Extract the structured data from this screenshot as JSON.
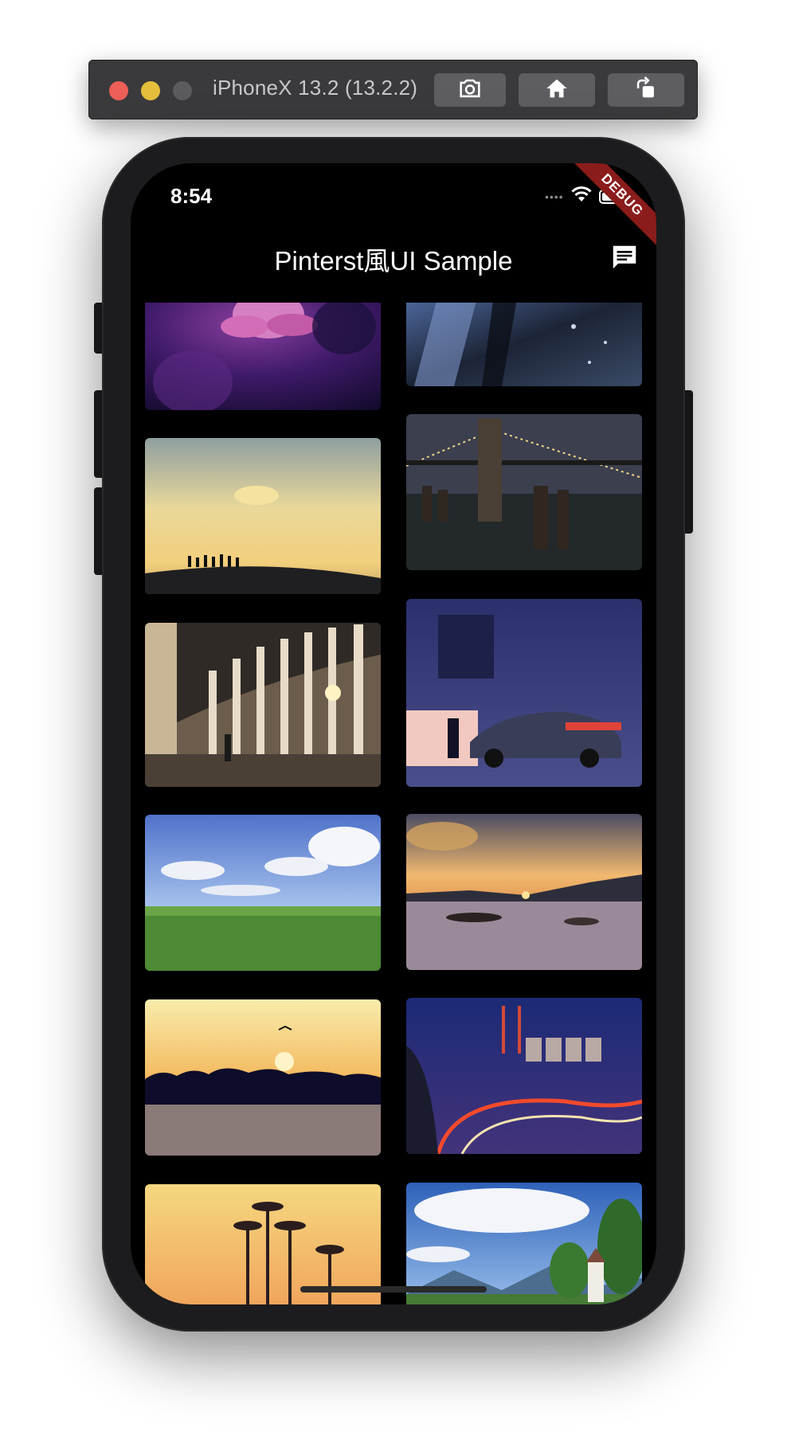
{
  "simulator": {
    "title": "iPhoneX 13.2 (13.2.2)",
    "buttons": [
      {
        "name": "screenshot",
        "icon": "camera-icon"
      },
      {
        "name": "home",
        "icon": "home-icon"
      },
      {
        "name": "rotate",
        "icon": "rotate-icon"
      }
    ]
  },
  "status_bar": {
    "time": "8:54",
    "signal": "••••"
  },
  "debug_banner": "DEBUG",
  "app_bar": {
    "title": "Pinterst風UI Sample",
    "action_icon": "chat-icon"
  },
  "images": {
    "left": [
      "lotus-flower",
      "sunset-hill-people",
      "architecture-colonnade",
      "green-field-sky",
      "sunset-lake-bird",
      "palm-trees-sunset"
    ],
    "right": [
      "rainy-window",
      "brooklyn-bridge-night",
      "garage-car-night",
      "lake-boats-sunset",
      "power-plant-highway",
      "alpine-chapel"
    ]
  }
}
